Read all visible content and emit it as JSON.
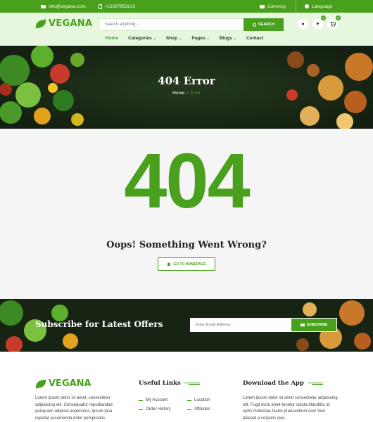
{
  "topbar": {
    "email": "info@vegana.com",
    "phone": "+12027953213",
    "currency": "Currency",
    "language": "Language"
  },
  "header": {
    "logo": "VEGANA",
    "search_placeholder": "Search anything...",
    "search_button": "SEARCH",
    "wishlist_count": "0",
    "cart_count": "0",
    "nav": [
      {
        "label": "Home",
        "active": true
      },
      {
        "label": "Categories"
      },
      {
        "label": "Shop"
      },
      {
        "label": "Pages"
      },
      {
        "label": "Blogs"
      },
      {
        "label": "Contact"
      }
    ]
  },
  "hero": {
    "title": "404 Error",
    "breadcrumb_home": "Home",
    "breadcrumb_sep": "/",
    "breadcrumb_current": "Error"
  },
  "error": {
    "code": "404",
    "title": "Oops! Something Went Wrong?",
    "button": "GO TO HOMEPAGE"
  },
  "subscribe": {
    "title": "Subscribe for Latest Offers",
    "placeholder": "Enter Email Address",
    "button": "SUBSCRIBE"
  },
  "footer": {
    "logo": "VEGANA",
    "about": "Lorem ipsum dolor sit amet, consectetur adipisicing elit. Consequatur repudiandae quisquam adipisci asperiores, ipsum ipsa repellat assumenda dolor perspiciatis.",
    "useful_links_title": "Useful Links",
    "links": [
      "My Account",
      "Location",
      "Order History",
      "Affiliates"
    ],
    "app_title": "Download the App",
    "app_text": "Lorem ipsum dolor sit amet consectetur adipisicing elit. Fugit dicta amet tenetur soluta blanditiis at optio molestias facilis praesentium eos! Sed placeat a corporis quo."
  },
  "colors": {
    "brand_green": "#49a01c",
    "header_bg": "#e7f7de",
    "dark_banner": "#1b2a17"
  }
}
